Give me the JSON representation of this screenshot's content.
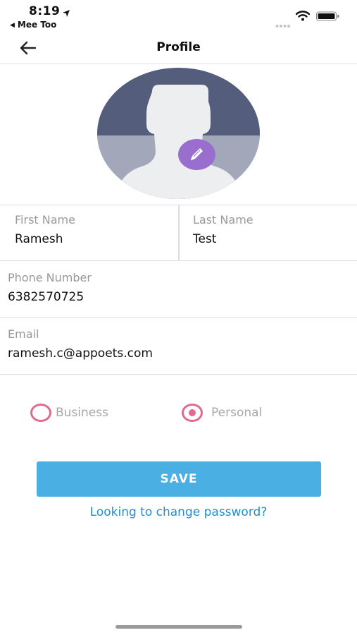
{
  "status_bar": {
    "time": "8:19",
    "back_app": "Mee Too"
  },
  "nav": {
    "title": "Profile"
  },
  "form": {
    "first_name": {
      "label": "First Name",
      "value": "Ramesh"
    },
    "last_name": {
      "label": "Last Name",
      "value": "Test"
    },
    "phone": {
      "label": "Phone Number",
      "value": "6382570725"
    },
    "email": {
      "label": "Email",
      "value": "ramesh.c@appoets.com"
    }
  },
  "account_type": {
    "options": [
      {
        "label": "Business",
        "selected": false
      },
      {
        "label": "Personal",
        "selected": true
      }
    ]
  },
  "actions": {
    "save_label": "SAVE",
    "change_password_label": "Looking to change password?"
  },
  "colors": {
    "accent_blue": "#4ab0e4",
    "link_blue": "#1e8fd6",
    "radio_pink": "#e06a92",
    "edit_purple": "#9a6ecf",
    "avatar_dark": "#545e7c"
  },
  "icons": {
    "back": "arrow-left-icon",
    "edit": "pencil-icon",
    "location": "location-arrow-icon",
    "signal": "cellular-signal-icon",
    "wifi": "wifi-icon",
    "battery": "battery-icon"
  }
}
